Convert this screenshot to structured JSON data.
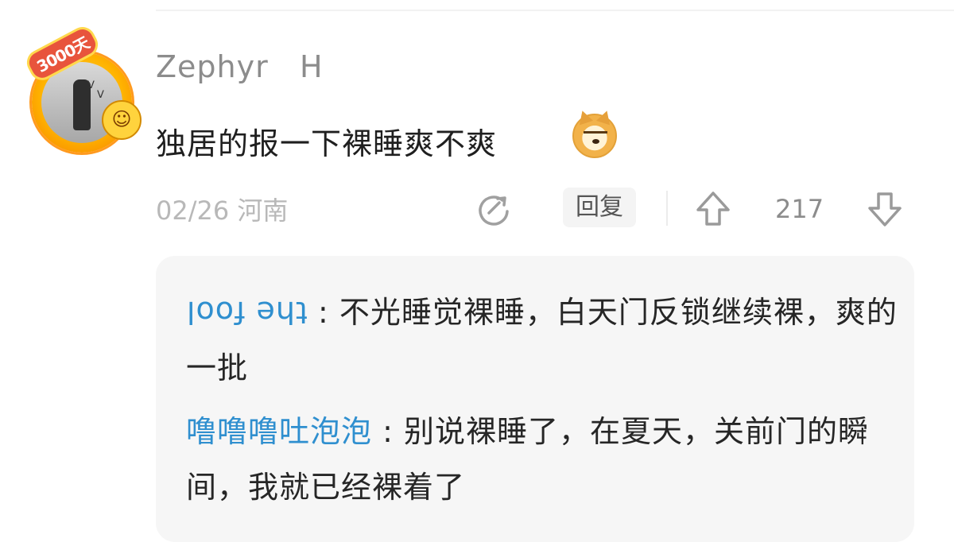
{
  "comment": {
    "avatar_badge": "3000天",
    "username": "Zephyr   H",
    "text": "独居的报一下裸睡爽不爽",
    "emoji_icon": "doge-icon",
    "date_location": "02/26 河南",
    "reply_label": "回复",
    "vote_count": "217"
  },
  "replies": [
    {
      "author": "the fool",
      "author_display": "upside-down",
      "text": "不光睡觉裸睡，白天门反锁继续裸，爽的一批"
    },
    {
      "author": "噜噜噜吐泡泡",
      "text": "别说裸睡了，在夏天，关前门的瞬间，我就已经裸着了"
    }
  ],
  "colors": {
    "author_blue": "#2f8fcf",
    "meta_gray": "#b8b8b8",
    "reply_bg": "#f6f6f6"
  }
}
